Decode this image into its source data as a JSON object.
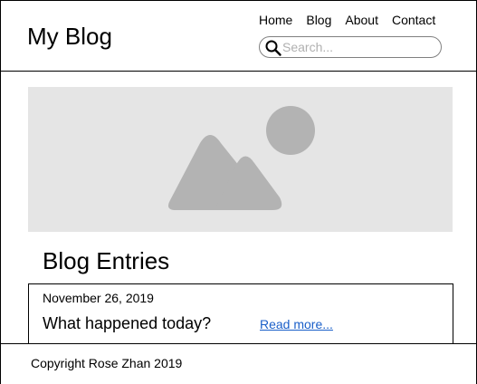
{
  "header": {
    "site_title": "My Blog",
    "nav": [
      "Home",
      "Blog",
      "About",
      "Contact"
    ],
    "search": {
      "placeholder": "Search...",
      "value": ""
    }
  },
  "hero": {
    "icon": "image-placeholder-icon"
  },
  "main": {
    "section_title": "Blog Entries",
    "entries": [
      {
        "date": "November 26, 2019",
        "title": "What happened today?",
        "read_more": "Read more..."
      }
    ]
  },
  "footer": {
    "copyright": "Copyright Rose Zhan 2019"
  },
  "colors": {
    "border": "#000000",
    "hero_background": "#e5e5e5",
    "placeholder_shape": "#b3b3b3",
    "link": "#1a5fc9"
  }
}
